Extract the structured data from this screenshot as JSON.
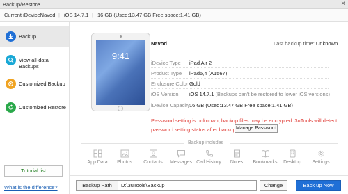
{
  "window": {
    "title": "Backup/Restore",
    "close_glyph": "×"
  },
  "device_bar": {
    "current": "Current iDeviceNavod",
    "ios": "iOS 14.7.1",
    "storage": "16 GB (Used:13.47 GB Free space:1.41 GB)"
  },
  "sidebar": {
    "items": [
      {
        "label": "Backup",
        "icon": "backup-icon",
        "color": "#1f6fd6",
        "active": true
      },
      {
        "label": "View all-data Backups",
        "icon": "view-backups-icon",
        "color": "#19a8d6",
        "active": false
      },
      {
        "label": "Customized Backup",
        "icon": "custom-backup-icon",
        "color": "#f0a321",
        "active": false
      },
      {
        "label": "Customized Restore",
        "icon": "custom-restore-icon",
        "color": "#2aa84a",
        "active": false
      }
    ],
    "tutorial_label": "Tutorial list",
    "difference_link": "What is the difference?"
  },
  "device": {
    "name": "Navod",
    "last_backup_label": "Last backup time:",
    "last_backup_value": "Unknown",
    "screen_time": "9:41",
    "info": [
      {
        "label": "iDevice Type",
        "value": "iPad Air 2"
      },
      {
        "label": "Product Type",
        "value": "iPad5,4 (A1567)"
      },
      {
        "label": "Enclosure Color",
        "value": "Gold"
      },
      {
        "label": "iOS Version",
        "value": "iOS 14.7.1",
        "note": " (Backups can't be restored to lower iOS versions)"
      },
      {
        "label": "iDevice Capacity",
        "value": "16 GB (Used:13.47 GB  Free space:1.41 GB)"
      }
    ]
  },
  "warning": {
    "text": "Password setting is unknown, backup files may be encrypted. 3uTools will detect password setting status after backup.",
    "manage_button": "Manage Password"
  },
  "backup_includes": {
    "title": "Backup includes",
    "items": [
      {
        "label": "App Data",
        "icon": "app-data-icon"
      },
      {
        "label": "Photos",
        "icon": "photos-icon"
      },
      {
        "label": "Contacts",
        "icon": "contacts-icon"
      },
      {
        "label": "Messages",
        "icon": "messages-icon"
      },
      {
        "label": "Call History",
        "icon": "call-history-icon"
      },
      {
        "label": "Notes",
        "icon": "notes-icon"
      },
      {
        "label": "Bookmarks",
        "icon": "bookmarks-icon"
      },
      {
        "label": "Desktop",
        "icon": "desktop-icon"
      },
      {
        "label": "Settings",
        "icon": "settings-icon"
      }
    ]
  },
  "bottom": {
    "path_label": "Backup Path",
    "path_value": "D:\\3uTools\\Backup",
    "change_button": "Change",
    "backup_button": "Back up Now"
  }
}
